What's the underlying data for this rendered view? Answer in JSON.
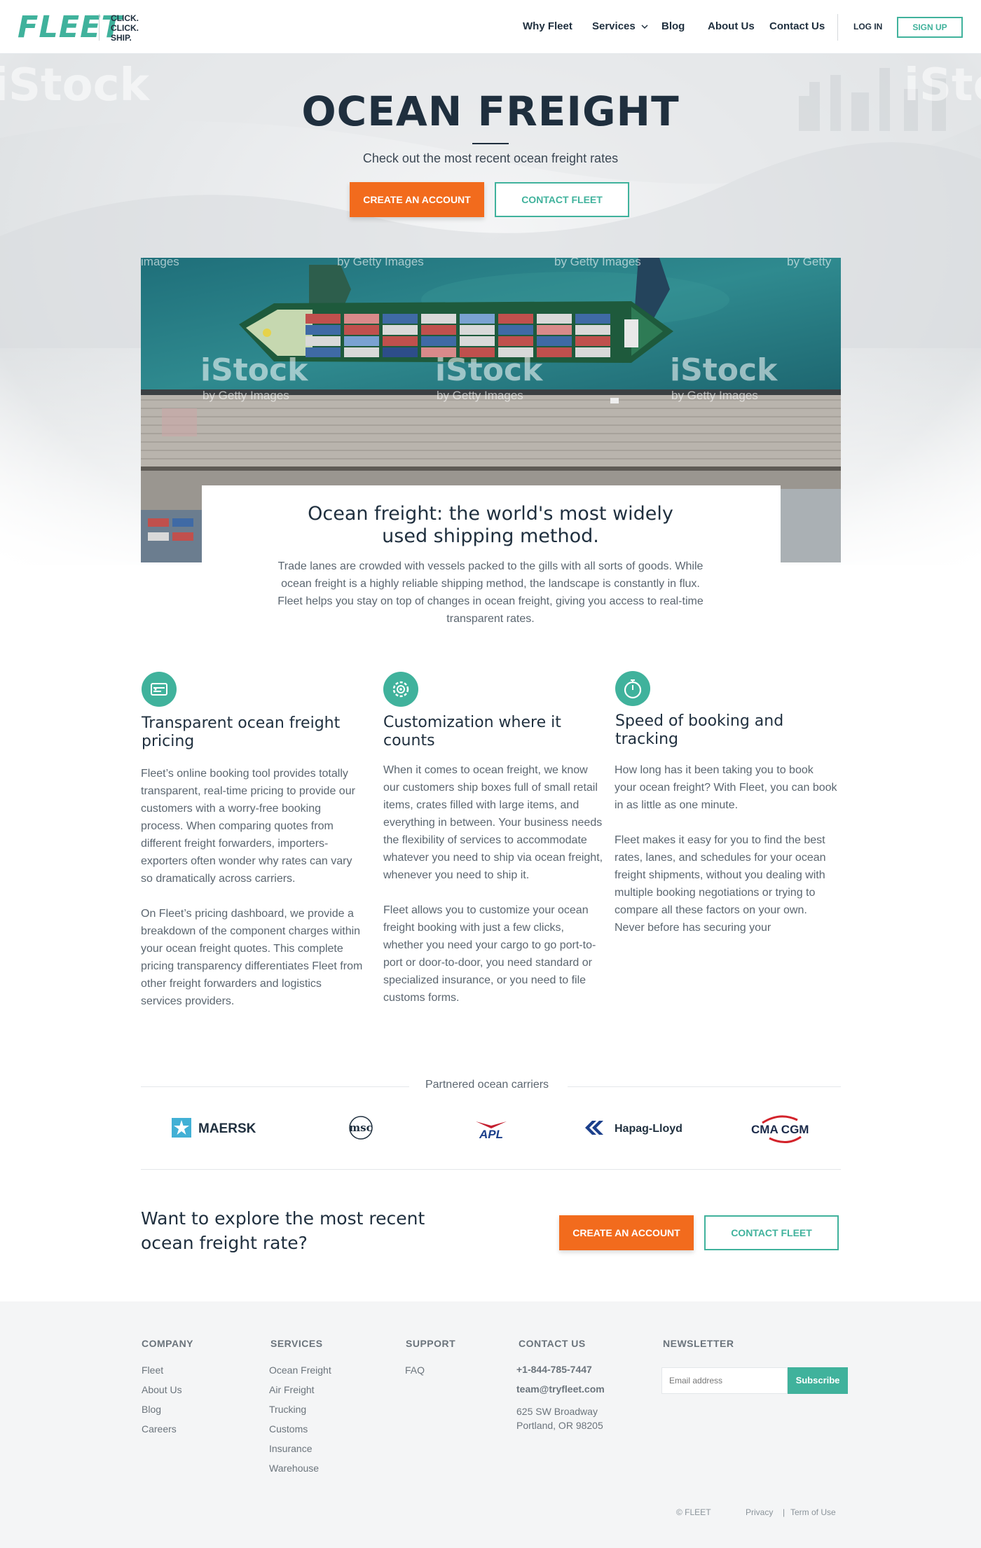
{
  "nav": {
    "logo": "FLEET",
    "tagline": [
      "CLICK.",
      "CLICK.",
      "SHIP."
    ],
    "links": [
      "Why Fleet",
      "Services",
      "Blog",
      "About Us",
      "Contact Us"
    ],
    "login": "LOG IN",
    "signup": "SIGN UP"
  },
  "hero": {
    "title": "OCEAN FREIGHT",
    "subtitle": "Check out the most recent ocean freight rates",
    "cta_primary": "CREATE AN ACCOUNT",
    "cta_secondary": "CONTACT FLEET"
  },
  "watermark": {
    "brand": "iStock",
    "credit": "by Getty Images",
    "fragment_top": "images",
    "fragment_right": "by Getty"
  },
  "intro": {
    "title_line1": "Ocean freight: the world's most widely",
    "title_line2": "used shipping method.",
    "body": "Trade lanes are crowded with vessels packed to the gills with all sorts of goods. While ocean freight is a highly reliable shipping method, the landscape is constantly in flux. Fleet helps you stay on top of changes in ocean freight, giving you access to real-time transparent rates."
  },
  "features": [
    {
      "icon": "pricing-tag-icon",
      "title": "Transparent ocean freight pricing",
      "paragraphs": [
        "Fleet’s online booking tool provides totally transparent, real-time pricing to provide our customers with a worry-free booking process. When comparing quotes from different freight forwarders, importers-exporters often wonder why rates can vary so dramatically across carriers.",
        "On Fleet’s pricing dashboard, we provide a breakdown of the component charges within your ocean freight quotes. This complete pricing transparency differentiates Fleet from other freight forwarders and logistics services providers."
      ]
    },
    {
      "icon": "gear-icon",
      "title": "Customization where it counts",
      "paragraphs": [
        "When it comes to ocean freight, we know our customers ship boxes full of small retail items, crates filled with large items, and everything in between. Your business needs the flexibility of services to accommodate whatever you need to ship via ocean freight, whenever you need to ship it.",
        "Fleet allows you to customize your ocean freight booking with just a few clicks, whether you need your cargo to go port-to-port or door-to-door, you need standard or specialized insurance, or you need to file customs forms."
      ]
    },
    {
      "icon": "stopwatch-icon",
      "title": "Speed of booking and tracking",
      "paragraphs": [
        "How long has it been taking you to book your ocean freight? With Fleet, you can book in as little as one minute.",
        "Fleet makes it easy for you to find the best rates, lanes, and schedules for your ocean freight shipments, without you dealing with multiple booking negotiations or trying to compare all these factors on your own. Never before has securing your"
      ]
    }
  ],
  "partners": {
    "label": "Partnered ocean carriers",
    "carriers": [
      "MAERSK",
      "msc",
      "APL",
      "Hapag-Lloyd",
      "CMA CGM"
    ]
  },
  "cta": {
    "text": "Want to explore the most recent ocean freight rate?",
    "primary": "CREATE AN ACCOUNT",
    "secondary": "CONTACT FLEET"
  },
  "footer": {
    "company": {
      "heading": "COMPANY",
      "links": [
        "Fleet",
        "About Us",
        "Blog",
        "Careers"
      ]
    },
    "services": {
      "heading": "SERVICES",
      "links": [
        "Ocean Freight",
        "Air Freight",
        "Trucking",
        "Customs",
        "Insurance",
        "Warehouse"
      ]
    },
    "support": {
      "heading": "SUPPORT",
      "links": [
        "FAQ"
      ]
    },
    "contact": {
      "heading": "CONTACT US",
      "phone": "+1-844-785-7447",
      "email": "team@tryfleet.com",
      "address_line1": "625 SW Broadway",
      "address_line2": "Portland, OR 98205"
    },
    "newsletter": {
      "heading": "NEWSLETTER",
      "placeholder": "Email address",
      "button": "Subscribe"
    },
    "copyright": "© FLEET",
    "privacy": "Privacy",
    "separator": "|",
    "terms": "Term of Use"
  },
  "colors": {
    "teal": "#40b29c",
    "orange": "#f26b1d",
    "navy": "#1f2f3e"
  }
}
